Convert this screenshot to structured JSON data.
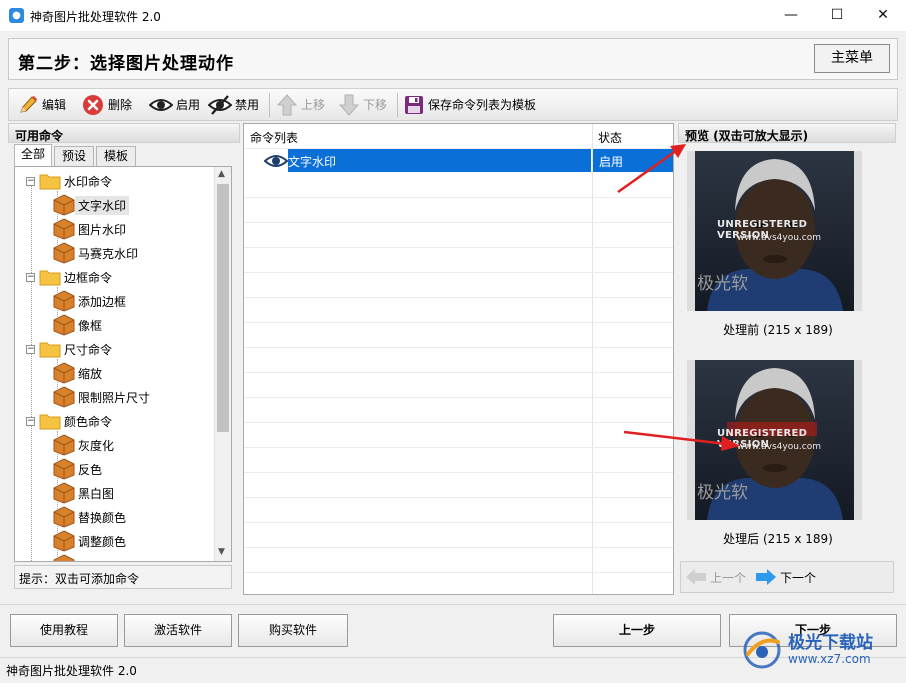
{
  "window": {
    "title": "神奇图片批处理软件 2.0",
    "icon_text": "●",
    "minimize": "—",
    "maximize": "☐",
    "close": "✕"
  },
  "step": {
    "title": "第二步：选择图片处理动作",
    "main_menu": "主菜单"
  },
  "toolbar": {
    "edit": "编辑",
    "delete": "删除",
    "enable": "启用",
    "disable": "禁用",
    "move_up": "上移",
    "move_down": "下移",
    "save_template": "保存命令列表为模板"
  },
  "left": {
    "header": "可用命令",
    "tabs": [
      "全部",
      "预设",
      "模板"
    ],
    "tree": [
      {
        "label": "水印命令",
        "kind": "folder"
      },
      {
        "label": "文字水印",
        "kind": "item",
        "selected": true
      },
      {
        "label": "图片水印",
        "kind": "item"
      },
      {
        "label": "马赛克水印",
        "kind": "item"
      },
      {
        "label": "边框命令",
        "kind": "folder"
      },
      {
        "label": "添加边框",
        "kind": "item"
      },
      {
        "label": "像框",
        "kind": "item"
      },
      {
        "label": "尺寸命令",
        "kind": "folder"
      },
      {
        "label": "缩放",
        "kind": "item"
      },
      {
        "label": "限制照片尺寸",
        "kind": "item"
      },
      {
        "label": "颜色命令",
        "kind": "folder"
      },
      {
        "label": "灰度化",
        "kind": "item"
      },
      {
        "label": "反色",
        "kind": "item"
      },
      {
        "label": "黑白图",
        "kind": "item"
      },
      {
        "label": "替换颜色",
        "kind": "item"
      },
      {
        "label": "调整颜色",
        "kind": "item"
      }
    ],
    "hint": "提示：双击可添加命令"
  },
  "commands": {
    "col_name": "命令列表",
    "col_status": "状态",
    "rows": [
      {
        "name": "文字水印",
        "status": "启用"
      }
    ]
  },
  "preview": {
    "header": "预览 (双击可放大显示)",
    "before_caption": "处理前 (215 x 189)",
    "after_caption": "处理后 (215 x 189)",
    "overlay_line1": "UNREGISTERED VERSION",
    "overlay_line2": "www.avs4you.com",
    "overlay_cn": "极光软",
    "prev": "上一个",
    "next": "下一个"
  },
  "bottom": {
    "tutorial": "使用教程",
    "activate": "激活软件",
    "buy": "购买软件",
    "prev_step": "上一步",
    "next_step": "下一步"
  },
  "status_bar": "神奇图片批处理软件 2.0",
  "site_watermark": {
    "name": "极光下载站",
    "url": "www.xz7.com"
  },
  "colors": {
    "selection": "#0a6fd6",
    "folder": "#f5c242",
    "box": "#d9822b",
    "delete_red": "#d93b3b",
    "arrow_red": "#e02020"
  }
}
